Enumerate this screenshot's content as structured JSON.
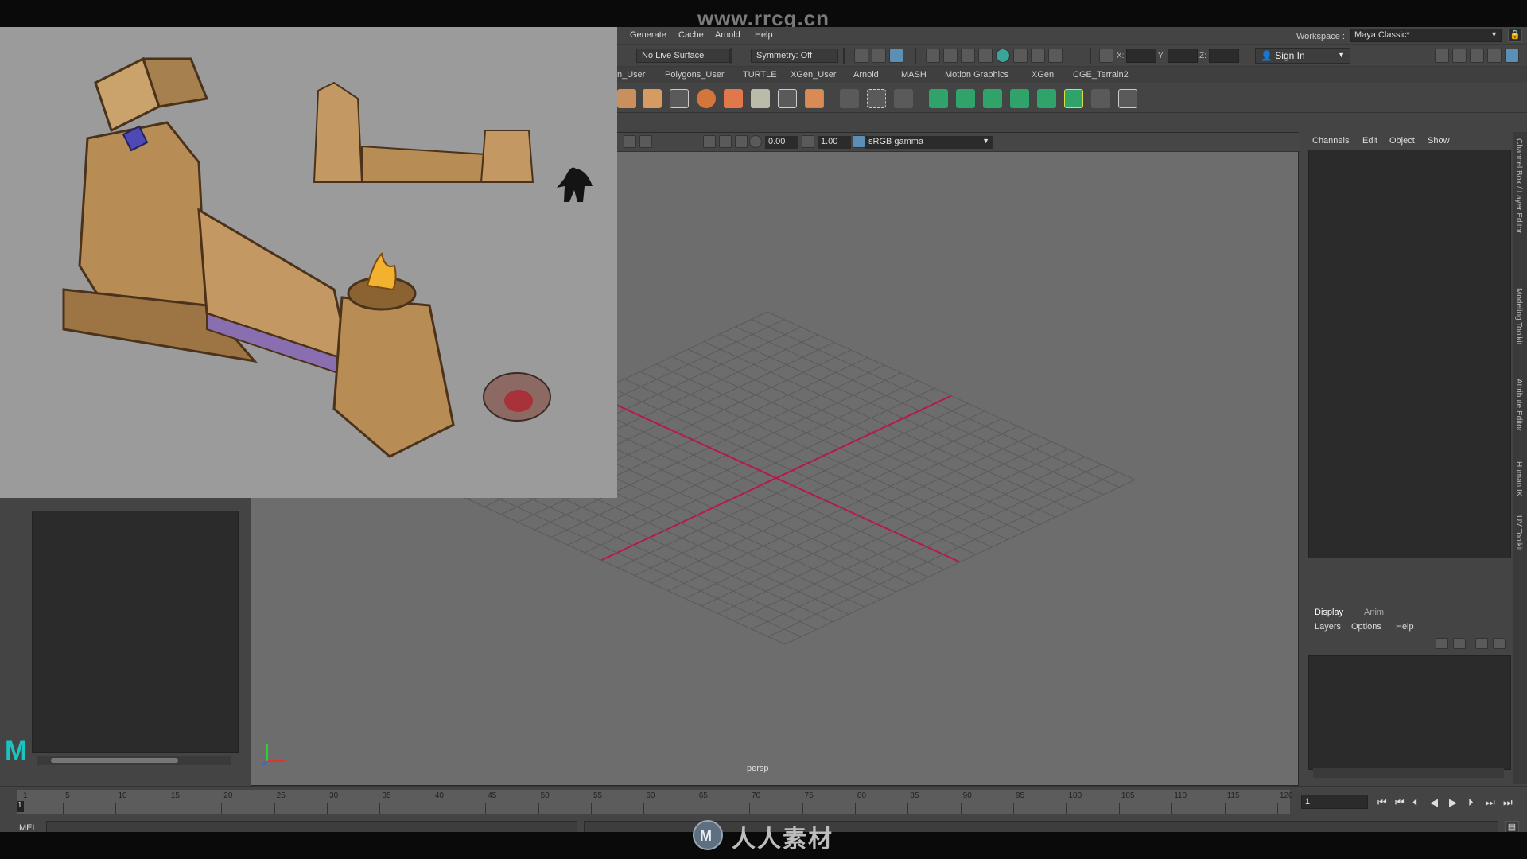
{
  "watermark_top": "www.rrcg.cn",
  "watermark_bottom": "人人素材",
  "menubar": {
    "items": [
      "Generate",
      "Cache",
      "Arnold",
      "Help"
    ],
    "workspace_label": "Workspace :",
    "workspace_value": "Maya Classic*"
  },
  "statusline": {
    "live_surface": "No Live Surface",
    "symmetry": "Symmetry: Off",
    "coord_x": "X:",
    "coord_y": "Y:",
    "coord_z": "Z:",
    "signin": "Sign In"
  },
  "shelf_tabs": [
    "n_User",
    "Polygons_User",
    "TURTLE",
    "XGen_User",
    "Arnold",
    "MASH",
    "Motion Graphics",
    "XGen",
    "CGE_Terrain2"
  ],
  "viewport": {
    "exposure": "0.00",
    "gamma": "1.00",
    "colorspace": "sRGB gamma",
    "camera": "persp"
  },
  "channel_box": {
    "menu": [
      "Channels",
      "Edit",
      "Object",
      "Show"
    ]
  },
  "layer_editor": {
    "tabs": [
      "Display",
      "Anim"
    ],
    "menu": [
      "Layers",
      "Options",
      "Help"
    ]
  },
  "side_tabs": [
    "Channel Box / Layer Editor",
    "Modeling Toolkit",
    "Attribute Editor",
    "Human IK",
    "UV Toolkit"
  ],
  "timeline": {
    "ticks": [
      "1",
      "5",
      "10",
      "15",
      "20",
      "25",
      "30",
      "35",
      "40",
      "45",
      "50",
      "55",
      "60",
      "65",
      "70",
      "75",
      "80",
      "85",
      "90",
      "95",
      "100",
      "105",
      "110",
      "115",
      "120"
    ],
    "current_frame": "1",
    "frame_field": "1"
  },
  "cmdline": {
    "label": "MEL"
  },
  "colors": {
    "grid_axis": "#b8174a",
    "maya_logo": "#19c5c0",
    "viewport_bg": "#6d6d6d"
  }
}
